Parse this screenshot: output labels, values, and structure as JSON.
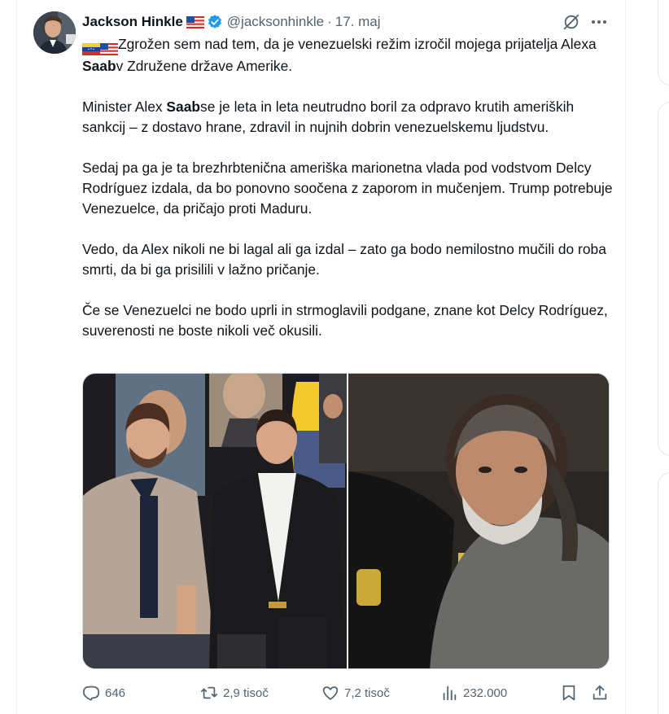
{
  "author": {
    "name": "Jackson Hinkle",
    "handle": "@jacksonhinkle",
    "separator": "·",
    "date": "17. maj"
  },
  "icons": {
    "avatar": "profile-photo",
    "flag_us": "us-flag-icon",
    "verified": "verified-badge-icon",
    "grok": "grok-icon",
    "more": "more-dots-icon",
    "flag_ve": "venezuela-flag-icon",
    "reply": "reply-icon",
    "retweet": "retweet-icon",
    "like": "heart-icon",
    "views": "views-chart-icon",
    "bookmark": "bookmark-icon",
    "share": "share-icon"
  },
  "tweet": {
    "p1_a": "Zgrožen sem nad tem, da je venezuelski režim izročil mojega prijatelja Alexa ",
    "p1_bold": "Saab",
    "p1_b": "v Združene države Amerike.",
    "p2_a": "Minister Alex ",
    "p2_bold": "Saab",
    "p2_b": "se je leta in leta neutrudno boril za odpravo krutih ameriških sankcij – z dostavo hrane, zdravil in nujnih dobrin venezuelskemu ljudstvu.",
    "p3": "Sedaj pa ga je ta brezhrbtenična ameriška marionetna vlada pod vodstvom Delcy Rodríguez izdala, da bo ponovno soočena z zaporom in mučenjem. Trump potrebuje Venezuelce, da pričajo proti Maduru.",
    "p4": "Vedo, da Alex nikoli ne bi lagal ali ga izdal – zato ga bodo nemilostno mučili do roba smrti, da bi ga prisilili v lažno pričanje.",
    "p5": "Če se Venezuelci ne bodo uprli in strmoglavili podgane, znane kot Delcy Rodríguez, suverenosti ne boste nikoli več okusili."
  },
  "stats": {
    "replies": "646",
    "retweets": "2,9 tisoč",
    "likes": "7,2 tisoč",
    "views": "232.000"
  },
  "colors": {
    "text": "#0f1419",
    "secondary": "#536471",
    "verified": "#1d9bf0",
    "border": "#eff3f4"
  }
}
